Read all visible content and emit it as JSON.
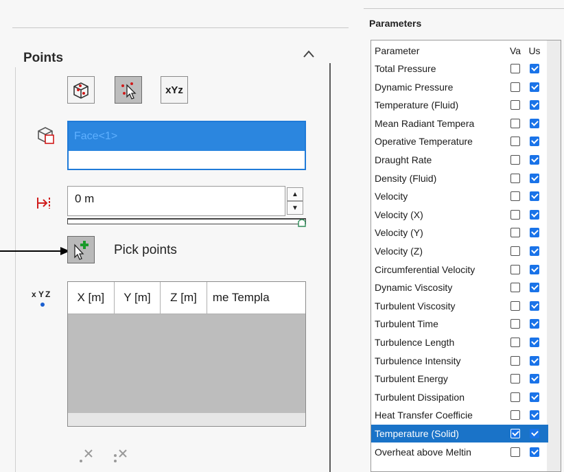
{
  "points_panel": {
    "title": "Points",
    "mode_buttons": [
      "select-on-face",
      "pick-points",
      "xyz-coordinates"
    ],
    "mode_xyz_label": "xYz",
    "face_list": {
      "selected_item": "Face<1>"
    },
    "offset": {
      "value": "0 m"
    },
    "pick_points_label": "Pick points",
    "table": {
      "columns": [
        "X [m]",
        "Y [m]",
        "Z [m]",
        "me Templa"
      ]
    }
  },
  "parameters_panel": {
    "title": "Parameters",
    "columns": [
      "Parameter",
      "Va",
      "Us"
    ],
    "rows": [
      {
        "name": "Total Pressure",
        "va": false,
        "us": true
      },
      {
        "name": "Dynamic Pressure",
        "va": false,
        "us": true
      },
      {
        "name": "Temperature (Fluid)",
        "va": false,
        "us": true
      },
      {
        "name": "Mean Radiant Tempera",
        "va": false,
        "us": true
      },
      {
        "name": "Operative Temperature",
        "va": false,
        "us": true
      },
      {
        "name": "Draught Rate",
        "va": false,
        "us": true
      },
      {
        "name": "Density (Fluid)",
        "va": false,
        "us": true
      },
      {
        "name": "Velocity",
        "va": false,
        "us": true
      },
      {
        "name": "Velocity (X)",
        "va": false,
        "us": true
      },
      {
        "name": "Velocity (Y)",
        "va": false,
        "us": true
      },
      {
        "name": "Velocity (Z)",
        "va": false,
        "us": true
      },
      {
        "name": "Circumferential Velocity",
        "va": false,
        "us": true
      },
      {
        "name": "Dynamic Viscosity",
        "va": false,
        "us": true
      },
      {
        "name": "Turbulent Viscosity",
        "va": false,
        "us": true
      },
      {
        "name": "Turbulent Time",
        "va": false,
        "us": true
      },
      {
        "name": "Turbulence Length",
        "va": false,
        "us": true
      },
      {
        "name": "Turbulence Intensity",
        "va": false,
        "us": true
      },
      {
        "name": "Turbulent Energy",
        "va": false,
        "us": true
      },
      {
        "name": "Turbulent Dissipation",
        "va": false,
        "us": true
      },
      {
        "name": "Heat Transfer Coefficie",
        "va": false,
        "us": true
      },
      {
        "name": "Temperature (Solid)",
        "va": true,
        "us": true,
        "selected": true
      },
      {
        "name": "Overheat above Meltin",
        "va": false,
        "us": true
      }
    ]
  },
  "colors": {
    "selection_blue": "#1a73c8",
    "checkbox_blue": "#1a73e8",
    "face_highlight": "#2b86df"
  }
}
